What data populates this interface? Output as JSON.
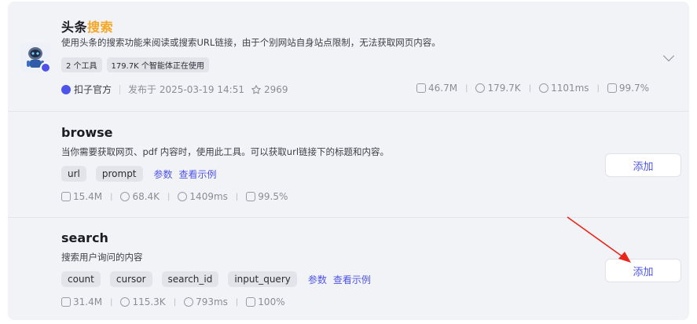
{
  "plugin": {
    "title_main": "头条",
    "title_highlight": "搜索",
    "description": "使用头条的搜索功能来阅读或搜索URL链接，由于个别网站自身站点限制，无法获取网页内容。",
    "tags": [
      "2 个工具",
      "179.7K 个智能体正在使用"
    ],
    "publisher": "扣子官方",
    "published": "发布于 2025-03-19 14:51",
    "stars": "2969",
    "stats": {
      "calls": "46.7M",
      "users": "179.7K",
      "latency": "1101ms",
      "success": "99.7%"
    }
  },
  "tools": [
    {
      "name": "browse",
      "description": "当你需要获取网页、pdf 内容时，使用此工具。可以获取url链接下的标题和内容。",
      "params": [
        "url",
        "prompt"
      ],
      "params_link": "参数",
      "example_link": "查看示例",
      "stats": {
        "calls": "15.4M",
        "users": "68.4K",
        "latency": "1409ms",
        "success": "99.5%"
      },
      "add_label": "添加"
    },
    {
      "name": "search",
      "description": "搜索用户询问的内容",
      "params": [
        "count",
        "cursor",
        "search_id",
        "input_query"
      ],
      "params_link": "参数",
      "example_link": "查看示例",
      "stats": {
        "calls": "31.4M",
        "users": "115.3K",
        "latency": "793ms",
        "success": "100%"
      },
      "add_label": "添加"
    }
  ],
  "colors": {
    "accent": "#4d53e8",
    "highlight": "#f5a623",
    "arrow": "#e8261c"
  }
}
